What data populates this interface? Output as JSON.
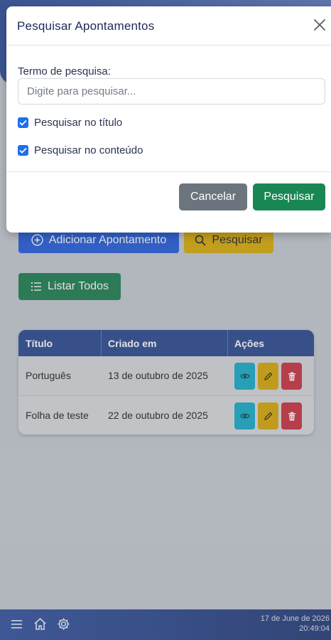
{
  "toolbar": {
    "add_label": "Adicionar Apontamento",
    "search_label": "Pesquisar",
    "list_label": "Listar Todos"
  },
  "table": {
    "headers": [
      "Título",
      "Criado em",
      "Ações"
    ],
    "rows": [
      {
        "title": "Português",
        "created": "13 de outubro de 2025"
      },
      {
        "title": "Folha de teste",
        "created": "22 de outubro de 2025"
      }
    ]
  },
  "footer": {
    "date": "17 de June de 2026",
    "time": "20:49:04"
  },
  "modal": {
    "title": "Pesquisar Apontamentos",
    "field_label": "Termo de pesquisa:",
    "placeholder": "Digite para pesquisar...",
    "value": "",
    "check_title_label": "Pesquisar no título",
    "check_title_checked": true,
    "check_content_label": "Pesquisar no conteúdo",
    "check_content_checked": true,
    "cancel_label": "Cancelar",
    "submit_label": "Pesquisar"
  },
  "colors": {
    "primary": "#1e58d6",
    "warning": "#d8a800",
    "success": "#198754",
    "danger": "#c82d3c",
    "info": "#11a9c5",
    "header": "#27448c"
  },
  "icons": {
    "add": "plus-circle-icon",
    "search": "search-icon",
    "list": "list-icon",
    "view": "eye-icon",
    "edit": "pencil-icon",
    "delete": "trash-icon",
    "menu": "menu-icon",
    "home": "home-icon",
    "settings": "gear-icon",
    "close": "close-icon",
    "check": "check-icon"
  }
}
